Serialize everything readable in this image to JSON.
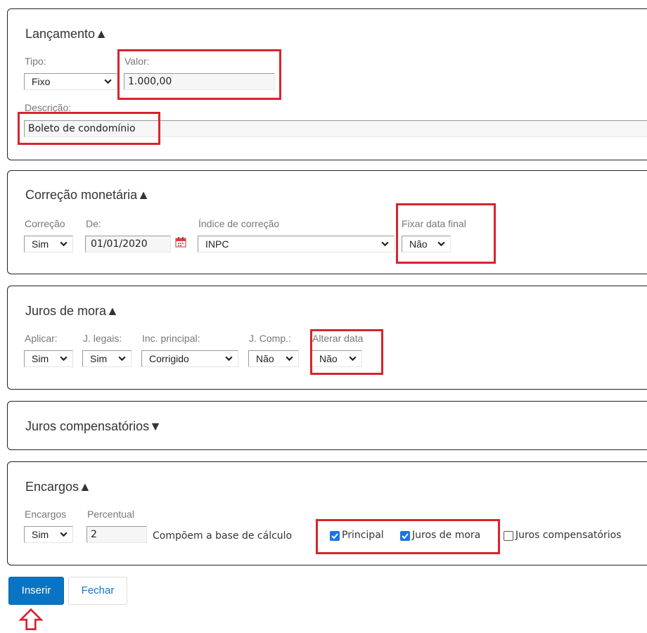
{
  "lancamento": {
    "title": "Lançamento▲",
    "tipo_label": "Tipo:",
    "tipo_value": "Fixo",
    "valor_label": "Valor:",
    "valor_value": "1.000,00",
    "descricao_label": "Descrição:",
    "descricao_value": "Boleto de condomínio"
  },
  "correcao": {
    "title": "Correção monetária▲",
    "correcao_label": "Correção",
    "correcao_value": "Sim",
    "de_label": "De:",
    "de_value": "01/01/2020",
    "indice_label": "Índice de correção",
    "indice_value": "INPC",
    "fixar_label": "Fixar data final",
    "fixar_value": "Não"
  },
  "juros_mora": {
    "title": "Juros de mora▲",
    "aplicar_label": "Aplicar:",
    "aplicar_value": "Sim",
    "legais_label": "J. legais:",
    "legais_value": "Sim",
    "inc_label": "Inc. principal:",
    "inc_value": "Corrigido",
    "comp_label": "J. Comp.:",
    "comp_value": "Não",
    "alterar_label": "Alterar data",
    "alterar_value": "Não"
  },
  "juros_comp": {
    "title": "Juros compensatórios▼"
  },
  "encargos": {
    "title": "Encargos▲",
    "encargos_label": "Encargos",
    "encargos_value": "Sim",
    "percentual_label": "Percentual",
    "percentual_value": "2",
    "base_text": "Compõem a base de cálculo",
    "cb_principal": "Principal",
    "cb_juros_mora": "Juros de mora",
    "cb_juros_comp": "Juros compensatórios"
  },
  "actions": {
    "inserir": "Inserir",
    "fechar": "Fechar"
  },
  "colors": {
    "highlight": "#d9232e",
    "primary": "#0a74c4",
    "checkbox": "#1a73e8"
  },
  "icons": [
    "chevron-down-icon",
    "calendar-icon",
    "up-arrow-outline-icon"
  ]
}
